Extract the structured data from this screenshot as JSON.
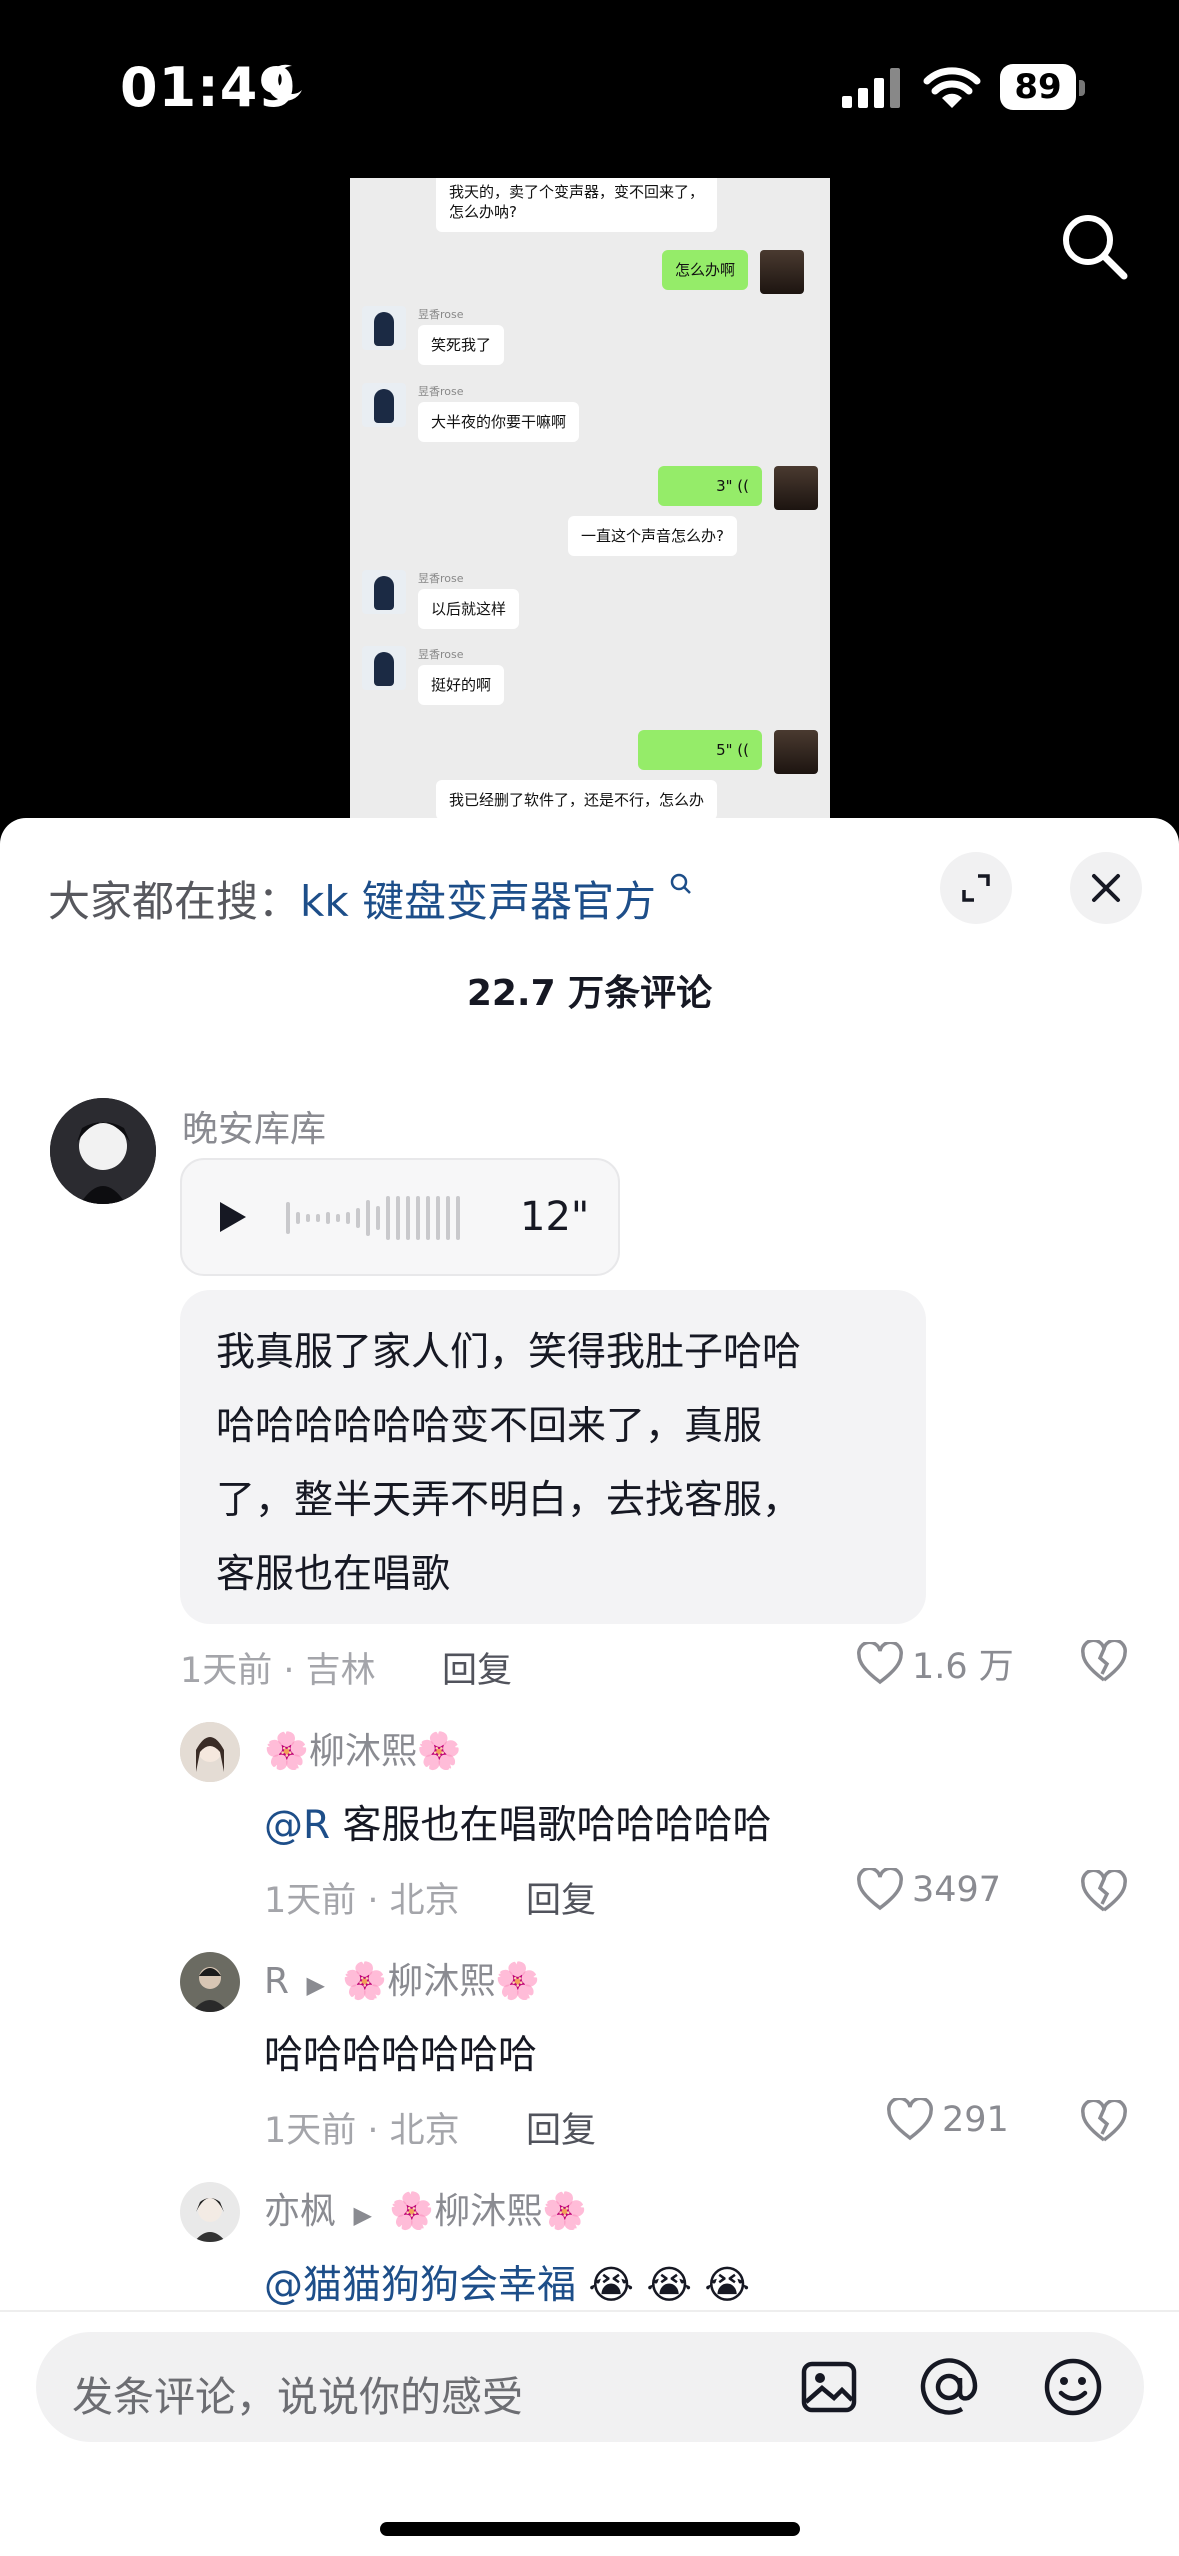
{
  "status_bar": {
    "time": "01:49",
    "battery": "89"
  },
  "chat_screenshot": {
    "messages": [
      {
        "side": "left",
        "text_lines": [
          "我天的，卖了个变声器，变不回来了，",
          "怎么办呐?"
        ]
      },
      {
        "side": "right",
        "text": "怎么办啊"
      },
      {
        "side": "left",
        "nick": "昱香rose",
        "text": "笑死我了"
      },
      {
        "side": "left",
        "nick": "昱香rose",
        "text": "大半夜的你要干嘛啊"
      },
      {
        "side": "right",
        "voice": "3\""
      },
      {
        "side": "left",
        "text": "一直这个声音怎么办?"
      },
      {
        "side": "left",
        "nick": "昱香rose",
        "text": "以后就这样"
      },
      {
        "side": "left",
        "nick": "昱香rose",
        "text": "挺好的啊"
      },
      {
        "side": "right",
        "voice": "5\""
      },
      {
        "side": "left",
        "text": "我已经删了软件了，还是不行，怎么办"
      }
    ]
  },
  "sheet": {
    "hot_search_prefix": "大家都在搜：",
    "hot_search_keyword": "kk 键盘变声器官方",
    "comment_count": "22.7 万条评论",
    "comments": [
      {
        "user": "晚安库库",
        "voice_duration": "12\"",
        "text_lines": [
          "我真服了家人们，笑得我肚子哈哈",
          "哈哈哈哈哈哈变不回来了，真服",
          "了，整半天弄不明白，去找客服，",
          "客服也在唱歌"
        ],
        "meta": "1天前 · 吉林",
        "reply": "回复",
        "likes": "1.6 万"
      },
      {
        "user": "柳沐熙",
        "user_decor": "🌸",
        "mention": "@R",
        "text": " 客服也在唱歌哈哈哈哈哈",
        "meta": "1天前 · 北京",
        "reply": "回复",
        "likes": "3497"
      },
      {
        "user": "R",
        "reply_to": "柳沐熙",
        "text": "哈哈哈哈哈哈哈",
        "meta": "1天前 · 北京",
        "reply": "回复",
        "likes": "291"
      },
      {
        "user": "亦枫",
        "reply_to": "柳沐熙",
        "mention": "@猫猫狗狗会幸福",
        "emoji": "😭 😭 😭"
      }
    ],
    "input_placeholder": "发条评论，说说你的感受"
  }
}
